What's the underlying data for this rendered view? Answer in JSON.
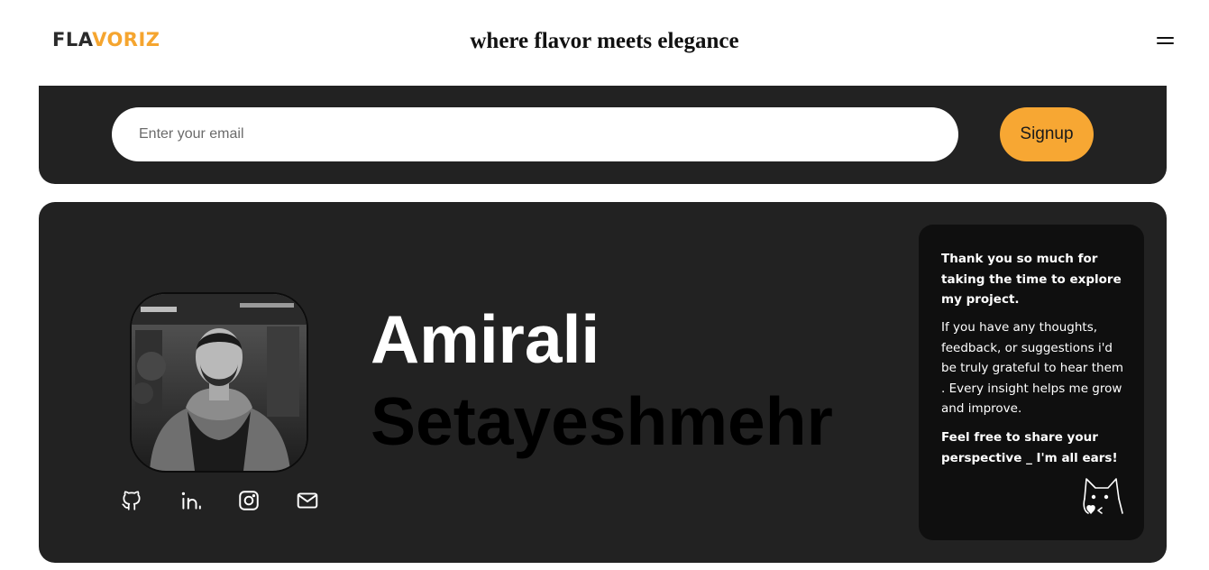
{
  "header": {
    "logo_part1": "FLA",
    "logo_part2": "VORIZ",
    "tagline": "where flavor meets elegance",
    "menu_icon": "hamburger-menu-icon"
  },
  "signup": {
    "email_placeholder": "Enter your email",
    "email_value": "",
    "button_label": "Signup"
  },
  "profile": {
    "first_name": "Amirali",
    "last_name": "Setayeshmehr",
    "avatar_icon": "profile-photo",
    "socials": [
      {
        "name": "github",
        "icon": "github-icon"
      },
      {
        "name": "linkedin",
        "icon": "linkedin-icon"
      },
      {
        "name": "instagram",
        "icon": "instagram-icon"
      },
      {
        "name": "email",
        "icon": "mail-icon"
      }
    ]
  },
  "thanks": {
    "heading": "Thank you so much for taking the time to explore my project.",
    "body": "If you have any thoughts, feedback, or suggestions i'd be truly grateful to hear them . Every insight helps me grow and improve.",
    "closing": "Feel free to share your perspective _ I'm all ears!",
    "icon": "cat-icon"
  },
  "colors": {
    "accent": "#f7a733",
    "panel": "#222222",
    "card": "#0f0f0f",
    "text_dark": "#111111"
  }
}
